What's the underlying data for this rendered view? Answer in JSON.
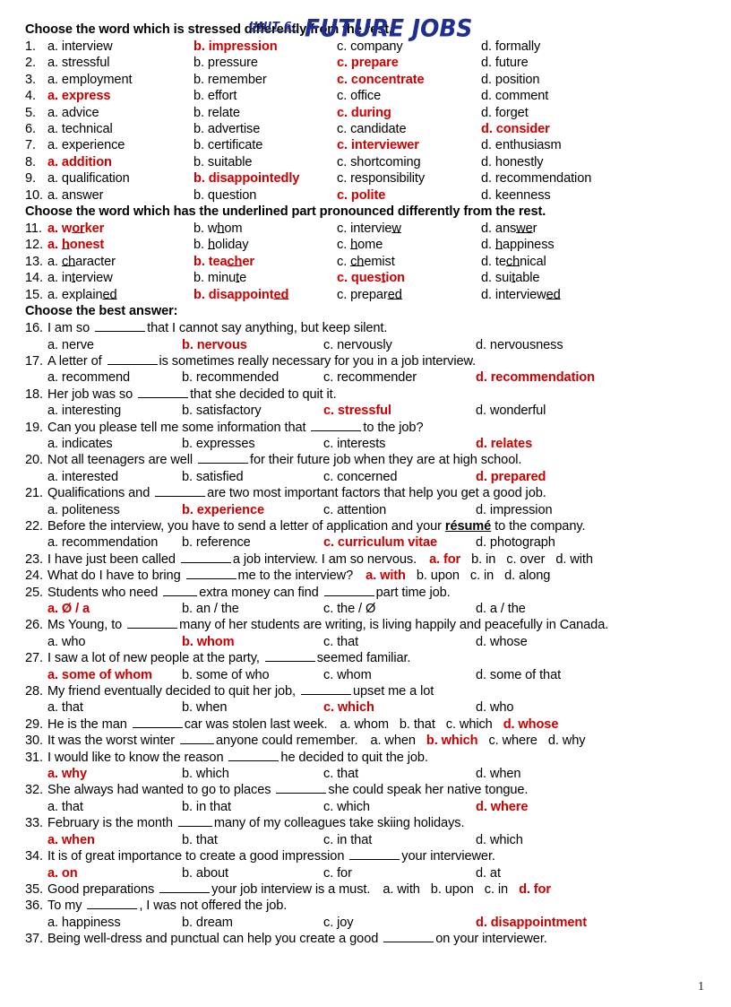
{
  "document": {
    "title_unit": "UNIT 6:",
    "title_main": "FUTURE JOBS",
    "page_number": "1",
    "accent_red": "#cc0000",
    "title_blue": "#1f2e91"
  },
  "sections": {
    "stress_heading": "Choose the word which is stressed differently from the rest.",
    "underline_heading": "Choose the word which has the underlined part pronounced differently from the rest.",
    "best_answer_heading": "Choose the best answer:"
  },
  "stress_questions": [
    {
      "num": "1.",
      "a": "a. interview",
      "b": "b. impression",
      "c": "c. company",
      "d": "d. formally",
      "answer": "b"
    },
    {
      "num": "2.",
      "a": "a. stressful",
      "b": "b. pressure",
      "c": "c. prepare",
      "d": "d. future",
      "answer": "c"
    },
    {
      "num": "3.",
      "a": "a. employment",
      "b": "b. remember",
      "c": "c. concentrate",
      "d": "d. position",
      "answer": "c"
    },
    {
      "num": "4.",
      "a": "a. express",
      "b": "b. effort",
      "c": "c. office",
      "d": "d. comment",
      "answer": "a"
    },
    {
      "num": "5.",
      "a": "a. advice",
      "b": "b. relate",
      "c": "c. during",
      "d": "d. forget",
      "answer": "c"
    },
    {
      "num": "6.",
      "a": "a. technical",
      "b": "b. advertise",
      "c": "c. candidate",
      "d": "d. consider",
      "answer": "d"
    },
    {
      "num": "7.",
      "a": "a. experience",
      "b": "b. certificate",
      "c": "c. interviewer",
      "d": "d. enthusiasm",
      "answer": "c"
    },
    {
      "num": "8.",
      "a": "a. addition",
      "b": "b. suitable",
      "c": "c. shortcoming",
      "d": "d. honestly",
      "answer": "a"
    },
    {
      "num": "9.",
      "a": "a. qualification",
      "b": "b. disappointedly",
      "c": "c. responsibility",
      "d": "d. recommendation",
      "answer": "b"
    },
    {
      "num": "10.",
      "a": "a. answer",
      "b": "b. question",
      "c": "c. polite",
      "d": "d. keenness",
      "answer": "c"
    }
  ],
  "underline_questions": [
    {
      "num": "11.",
      "answer": "a",
      "a": {
        "pre": "a. w",
        "u": "or",
        "post": "ker"
      },
      "b": {
        "pre": "b. w",
        "u": "h",
        "post": "om"
      },
      "c": {
        "pre": "c. intervie",
        "u": "w",
        "post": ""
      },
      "d": {
        "pre": "d. ans",
        "u": "we",
        "post": "r"
      }
    },
    {
      "num": "12.",
      "answer": "a",
      "a": {
        "pre": "a. ",
        "u": "h",
        "post": "onest"
      },
      "b": {
        "pre": "b. ",
        "u": "h",
        "post": "oliday"
      },
      "c": {
        "pre": "c. ",
        "u": "h",
        "post": "ome"
      },
      "d": {
        "pre": "d. ",
        "u": "h",
        "post": "appiness"
      }
    },
    {
      "num": "13.",
      "answer": "b",
      "a": {
        "pre": "a. ",
        "u": "ch",
        "post": "aracter"
      },
      "b": {
        "pre": "b. tea",
        "u": "ch",
        "post": "er"
      },
      "c": {
        "pre": "c. ",
        "u": "ch",
        "post": "emist"
      },
      "d": {
        "pre": "d. te",
        "u": "ch",
        "post": "nical"
      }
    },
    {
      "num": "14.",
      "answer": "c",
      "a": {
        "pre": "a. in",
        "u": "t",
        "post": "erview"
      },
      "b": {
        "pre": "b. minu",
        "u": "t",
        "post": "e"
      },
      "c": {
        "pre": "c. ques",
        "u": "t",
        "post": "ion"
      },
      "d": {
        "pre": "d. sui",
        "u": "t",
        "post": "able"
      }
    },
    {
      "num": "15.",
      "answer": "b",
      "a": {
        "pre": "a. explain",
        "u": "ed",
        "post": ""
      },
      "b": {
        "pre": "b. disappoint",
        "u": "ed",
        "post": ""
      },
      "c": {
        "pre": "c. prepar",
        "u": "ed",
        "post": ""
      },
      "d": {
        "pre": "d. interview",
        "u": "ed",
        "post": ""
      }
    }
  ],
  "best_answer_questions": [
    {
      "num": "16.",
      "layout": "stacked",
      "stem_pre": "I am so ",
      "blank": "w1",
      "stem_post": "that I cannot say anything, but keep silent.",
      "options": [
        "a. nerve",
        "b. nervous",
        "c. nervously",
        "d. nervousness"
      ],
      "answer": 1
    },
    {
      "num": "17.",
      "layout": "stacked",
      "stem_pre": "A letter of ",
      "blank": "w1",
      "stem_post": "is sometimes really necessary for you in a job interview.",
      "options": [
        "a. recommend",
        "b. recommended",
        "c. recommender",
        "d. recommendation"
      ],
      "answer": 3
    },
    {
      "num": "18.",
      "layout": "stacked",
      "stem_pre": "Her job was so ",
      "blank": "w1",
      "stem_post": "that she decided to quit it.",
      "options": [
        "a. interesting",
        "b. satisfactory",
        "c. stressful",
        "d. wonderful"
      ],
      "answer": 2
    },
    {
      "num": "19.",
      "layout": "stacked",
      "stem_pre": "Can you please tell me some information that ",
      "blank": "w1",
      "stem_post": "to the job?",
      "options": [
        "a. indicates",
        "b. expresses",
        "c. interests",
        "d. relates"
      ],
      "answer": 3
    },
    {
      "num": "20.",
      "layout": "stacked",
      "stem_pre": "Not all teenagers are well ",
      "blank": "w1",
      "stem_post": "for their future job when they are at high school.",
      "options": [
        "a. interested",
        "b. satisfied",
        "c. concerned",
        "d. prepared"
      ],
      "answer": 3
    },
    {
      "num": "21.",
      "layout": "stacked",
      "stem_pre": "Qualifications and ",
      "blank": "w1",
      "stem_post": "are two most important factors that help you get a good job.",
      "options": [
        "a. politeness",
        "b. experience",
        "c. attention",
        "d. impression"
      ],
      "answer": 1
    },
    {
      "num": "22.",
      "layout": "stacked-resume",
      "stem_pre": "Before the interview, you have to send a letter of application and your ",
      "resume_word": "résumé",
      "stem_post": " to the company.",
      "options": [
        "a. recommendation",
        "b. reference",
        "c. curriculum vitae",
        "d. photograph"
      ],
      "answer": 2
    },
    {
      "num": "23.",
      "layout": "inline",
      "stem_pre": "I have just been called ",
      "blank": "w1",
      "stem_post": "a job interview. I am so nervous.",
      "options": [
        "a. for",
        "b. in",
        "c. over",
        "d. with"
      ],
      "answer": 0
    },
    {
      "num": "24.",
      "layout": "inline",
      "stem_pre": "What do I have to bring ",
      "blank": "w1",
      "stem_post": "me to the interview?",
      "options": [
        "a. with",
        "b. upon",
        "c. in",
        "d. along"
      ],
      "answer": 0
    },
    {
      "num": "25.",
      "layout": "stacked2",
      "stem_pre": "Students who need ",
      "blank": "w2",
      "stem_mid": "extra money can find ",
      "blank2": "w1",
      "stem_post": "part time job.",
      "options": [
        "a. Ø / a",
        "b. an / the",
        "c. the / Ø",
        "d. a / the"
      ],
      "answer": 0
    },
    {
      "num": "26.",
      "layout": "stacked",
      "stem_pre": "Ms Young, to ",
      "blank": "w1",
      "stem_post": "many of her students are writing, is living happily and peacefully in Canada.",
      "options": [
        "a. who",
        "b. whom",
        "c. that",
        "d. whose"
      ],
      "answer": 1
    },
    {
      "num": "27.",
      "layout": "stacked",
      "stem_pre": "I saw a lot of new people at the party, ",
      "blank": "w1",
      "stem_post": "seemed familiar.",
      "options": [
        "a. some of whom",
        "b. some of who",
        "c. whom",
        "d. some of that"
      ],
      "answer": 0
    },
    {
      "num": "28.",
      "layout": "stacked",
      "stem_pre": "My friend eventually decided to quit her job, ",
      "blank": "w1",
      "stem_post": "upset me a lot",
      "options": [
        "a. that",
        "b. when",
        "c. which",
        "d. who"
      ],
      "answer": 2
    },
    {
      "num": "29.",
      "layout": "inline",
      "stem_pre": "He is the man ",
      "blank": "w1",
      "stem_post": "car was stolen last week.",
      "options": [
        "a. whom",
        "b. that",
        "c. which",
        "d. whose"
      ],
      "answer": 3
    },
    {
      "num": "30.",
      "layout": "inline",
      "stem_pre": "It was the worst winter ",
      "blank": "w2",
      "stem_post": "anyone could remember.",
      "options": [
        "a. when",
        "b. which",
        "c. where",
        "d. why"
      ],
      "answer": 1
    },
    {
      "num": "31.",
      "layout": "stacked",
      "stem_pre": "I would like to know the reason ",
      "blank": "w1",
      "stem_post": "he decided to quit the job.",
      "options": [
        "a. why",
        "b. which",
        "c. that",
        "d. when"
      ],
      "answer": 0
    },
    {
      "num": "32.",
      "layout": "stacked",
      "stem_pre": "She always had wanted to go to places ",
      "blank": "w1",
      "stem_post": "she could speak her native tongue.",
      "options": [
        "a. that",
        "b. in that",
        "c. which",
        "d. where"
      ],
      "answer": 3
    },
    {
      "num": "33.",
      "layout": "stacked",
      "stem_pre": "February is the month ",
      "blank": "w2",
      "stem_post": "many of my colleagues take skiing holidays.",
      "options": [
        "a. when",
        "b. that",
        "c. in that",
        "d. which"
      ],
      "answer": 0
    },
    {
      "num": "34.",
      "layout": "stacked",
      "stem_pre": "It is of great importance to create a good impression ",
      "blank": "w1",
      "stem_post": "your interviewer.",
      "options": [
        "a. on",
        "b. about",
        "c. for",
        "d. at"
      ],
      "answer": 0
    },
    {
      "num": "35.",
      "layout": "inline",
      "stem_pre": "Good preparations ",
      "blank": "w1",
      "stem_post": "your job interview is a must.",
      "options": [
        "a. with",
        "b. upon",
        "c. in",
        "d. for"
      ],
      "answer": 3
    },
    {
      "num": "36.",
      "layout": "stacked",
      "stem_pre": "To my ",
      "blank": "w1",
      "stem_post": ", I was not offered the job.",
      "options": [
        "a. happiness",
        "b. dream",
        "c. joy",
        "d. disappointment"
      ],
      "answer": 3
    },
    {
      "num": "37.",
      "layout": "stem-only",
      "stem_pre": "Being well-dress and punctual can help you create a good ",
      "blank": "w1",
      "stem_post": "on your interviewer.",
      "options": [],
      "answer": -1
    }
  ]
}
